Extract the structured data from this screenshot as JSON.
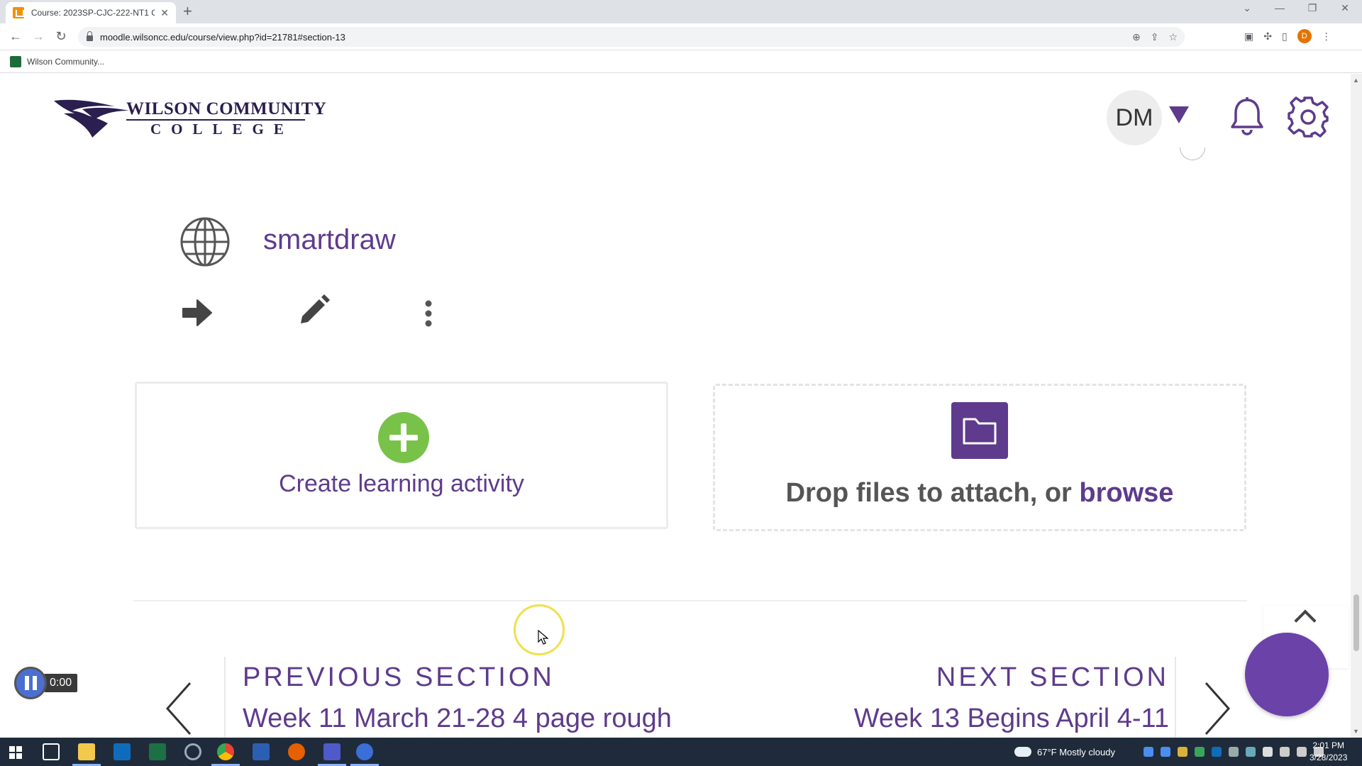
{
  "browser": {
    "tab_title": "Course: 2023SP-CJC-222-NT1 Cr",
    "tab_close": "✕",
    "new_tab": "+",
    "url": "moodle.wilsoncc.edu/course/view.php?id=21781#section-13",
    "bookmark_label": "Wilson Community...",
    "profile_initial": "D"
  },
  "site": {
    "logo_line1": "WILSON COMMUNITY",
    "logo_line2": "COLLEGE",
    "user_initials": "DM"
  },
  "activity": {
    "name": "smartdraw",
    "icon": "globe-icon"
  },
  "create_activity": {
    "label": "Create learning activity"
  },
  "dropzone": {
    "prefix": "Drop files to attach, or ",
    "link": "browse"
  },
  "section_nav": {
    "previous_heading": "PREVIOUS SECTION",
    "previous_title": "Week 11 March 21-28 4 page rough",
    "next_heading": "NEXT SECTION",
    "next_title": "Week 13 Begins April 4-11"
  },
  "recorder": {
    "time": "0:00"
  },
  "taskbar": {
    "weather": "67°F  Mostly cloudy",
    "time": "2:01 PM",
    "date": "3/28/2023"
  },
  "colors": {
    "brand_purple": "#5e3b8c",
    "create_green": "#79c24a"
  }
}
